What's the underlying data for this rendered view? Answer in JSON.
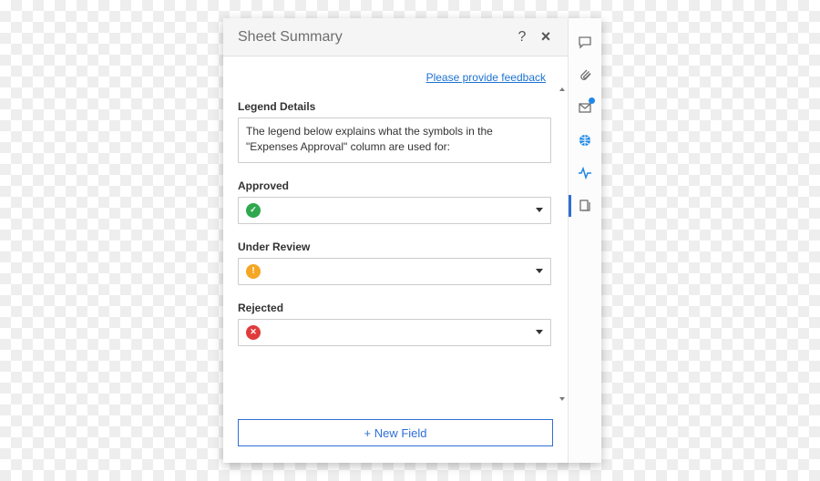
{
  "header": {
    "title": "Sheet Summary",
    "help_tooltip": "?",
    "close_tooltip": "×"
  },
  "feedback_link": "Please provide feedback",
  "fields": [
    {
      "label": "Legend Details",
      "type": "text",
      "value": "The legend below explains what the symbols in the \"Expenses Approval\" column are used for:"
    },
    {
      "label": "Approved",
      "type": "symbol-select",
      "symbol": "approved"
    },
    {
      "label": "Under Review",
      "type": "symbol-select",
      "symbol": "review"
    },
    {
      "label": "Rejected",
      "type": "symbol-select",
      "symbol": "rejected"
    }
  ],
  "new_field_label": "+ New Field",
  "rail": {
    "items": [
      {
        "name": "comments-icon",
        "kind": "comment",
        "active": false,
        "badge": false
      },
      {
        "name": "attachments-icon",
        "kind": "clip",
        "active": false,
        "badge": false
      },
      {
        "name": "inbox-icon",
        "kind": "inbox",
        "active": false,
        "badge": true
      },
      {
        "name": "publish-icon",
        "kind": "globe",
        "active": false,
        "badge": false
      },
      {
        "name": "activity-icon",
        "kind": "activity",
        "active": false,
        "badge": false
      },
      {
        "name": "summary-icon",
        "kind": "summary",
        "active": true,
        "badge": false
      }
    ]
  }
}
